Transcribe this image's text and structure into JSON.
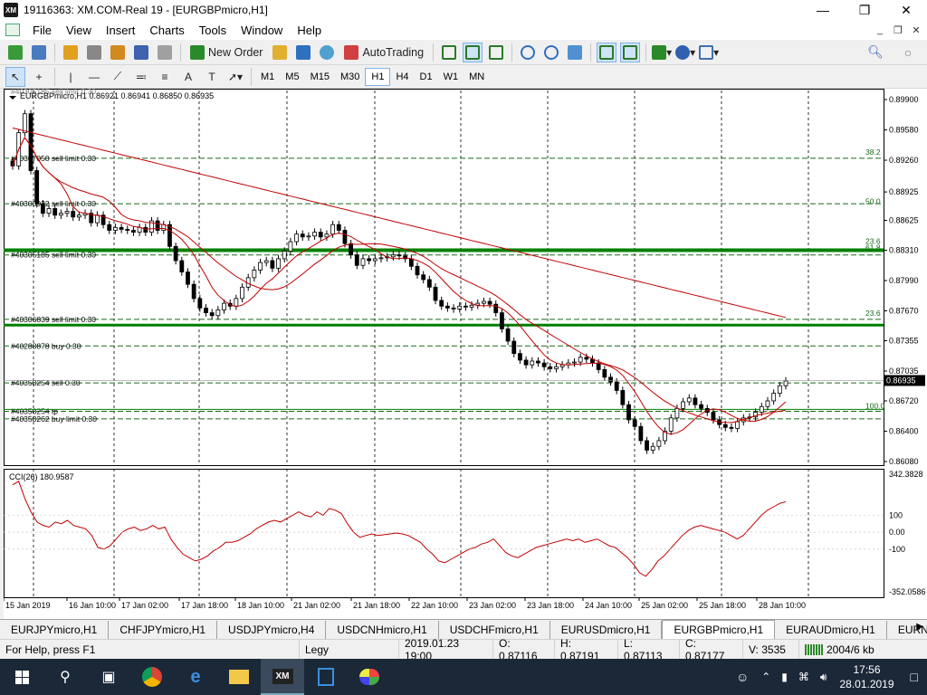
{
  "window": {
    "title": "19116363: XM.COM-Real 19 - [EURGBPmicro,H1]",
    "icon_text": "XM"
  },
  "menu": [
    "File",
    "View",
    "Insert",
    "Charts",
    "Tools",
    "Window",
    "Help"
  ],
  "toolbar": {
    "new_order": "New Order",
    "auto_trading": "AutoTrading"
  },
  "timeframes": [
    "M1",
    "M5",
    "M15",
    "M30",
    "H1",
    "H4",
    "D1",
    "W1",
    "MN"
  ],
  "active_timeframe": "H1",
  "chart_data": {
    "type": "candlestick",
    "symbol_header": "EURGBPmicro,H1  0.86921 0.86941 0.86850 0.86935",
    "y_ticks": [
      "0.89900",
      "0.89580",
      "0.89260",
      "0.88925",
      "0.88625",
      "0.88310",
      "0.87990",
      "0.87670",
      "0.87355",
      "0.87035",
      "0.86720",
      "0.86400",
      "0.86080"
    ],
    "current_price": "0.86935",
    "x_ticks": [
      "15 Jan 2019",
      "16 Jan 10:00",
      "17 Jan 02:00",
      "17 Jan 18:00",
      "18 Jan 10:00",
      "21 Jan 02:00",
      "21 Jan 18:00",
      "22 Jan 10:00",
      "23 Jan 02:00",
      "23 Jan 18:00",
      "24 Jan 10:00",
      "25 Jan 02:00",
      "25 Jan 18:00",
      "28 Jan 10:00"
    ],
    "close": [
      0.892,
      0.8955,
      0.8975,
      0.8915,
      0.888,
      0.887,
      0.8875,
      0.8868,
      0.887,
      0.8872,
      0.8866,
      0.8868,
      0.887,
      0.886,
      0.8868,
      0.8858,
      0.8852,
      0.8855,
      0.8853,
      0.8852,
      0.885,
      0.8855,
      0.885,
      0.8862,
      0.8852,
      0.8858,
      0.8835,
      0.882,
      0.8808,
      0.8795,
      0.878,
      0.877,
      0.8765,
      0.8762,
      0.8768,
      0.8775,
      0.8772,
      0.878,
      0.8792,
      0.8802,
      0.881,
      0.8818,
      0.882,
      0.8812,
      0.8822,
      0.883,
      0.884,
      0.8848,
      0.8845,
      0.8846,
      0.885,
      0.8845,
      0.8848,
      0.8858,
      0.8852,
      0.8838,
      0.8826,
      0.8815,
      0.8822,
      0.882,
      0.8822,
      0.8823,
      0.8824,
      0.8826,
      0.8825,
      0.8822,
      0.8814,
      0.8805,
      0.88,
      0.8792,
      0.8778,
      0.8772,
      0.877,
      0.8769,
      0.8772,
      0.8771,
      0.8773,
      0.8775,
      0.8777,
      0.8774,
      0.8765,
      0.8748,
      0.8735,
      0.8722,
      0.8715,
      0.871,
      0.8714,
      0.8712,
      0.8708,
      0.8706,
      0.8708,
      0.871,
      0.8712,
      0.8713,
      0.8718,
      0.8716,
      0.8712,
      0.8705,
      0.8697,
      0.8692,
      0.8683,
      0.8668,
      0.8652,
      0.8645,
      0.863,
      0.862,
      0.8624,
      0.863,
      0.864,
      0.8654,
      0.8664,
      0.8671,
      0.8675,
      0.8668,
      0.8664,
      0.866,
      0.8652,
      0.8647,
      0.8644,
      0.8643,
      0.865,
      0.8654,
      0.8655,
      0.866,
      0.8666,
      0.8672,
      0.868,
      0.8688,
      0.8693
    ],
    "annotations": [
      {
        "label": "#40307050 sell limit 0.30",
        "price": 0.8928
      },
      {
        "label": "#40300932 sell limit 0.30",
        "price": 0.888
      },
      {
        "label": "#40305185 sell limit 0.30",
        "price": 0.8826
      },
      {
        "label": "#40306839 sell limit 0.30",
        "price": 0.8758
      },
      {
        "label": "#40288878 buy 0.30",
        "price": 0.873
      },
      {
        "label": "#40358254 sell 0.30",
        "price": 0.8691
      },
      {
        "label": "#40358254 tp",
        "price": 0.8661
      },
      {
        "label": "#40358262 buy limit 0.30",
        "price": 0.8653
      }
    ],
    "top_order_label": "#40305185 sell limit 0.30",
    "fib_levels": [
      {
        "label": "38.2",
        "price": 0.893
      },
      {
        "label": "50.0",
        "price": 0.8878
      },
      {
        "label": "23.6",
        "price": 0.8836
      },
      {
        "label": "61.8",
        "price": 0.8829
      },
      {
        "label": "23.6",
        "price": 0.876
      },
      {
        "label": "100.0",
        "price": 0.8662
      }
    ],
    "indicator": {
      "title": "CCI(26) 180.9587",
      "y_ticks": [
        "342.3828",
        "100",
        "0.00",
        "-100",
        "-352.0586"
      ],
      "values": [
        280,
        300,
        200,
        120,
        60,
        40,
        30,
        60,
        50,
        70,
        40,
        30,
        20,
        -20,
        -90,
        -100,
        -80,
        -40,
        0,
        20,
        30,
        10,
        20,
        40,
        20,
        30,
        -40,
        -90,
        -130,
        -150,
        -170,
        -160,
        -140,
        -110,
        -90,
        -60,
        -60,
        -50,
        -30,
        -10,
        20,
        40,
        60,
        70,
        60,
        80,
        100,
        120,
        100,
        90,
        120,
        100,
        140,
        130,
        110,
        50,
        0,
        -30,
        -20,
        -10,
        -20,
        -15,
        -10,
        -5,
        -10,
        -20,
        -40,
        -60,
        -100,
        -130,
        -170,
        -180,
        -160,
        -140,
        -120,
        -100,
        -90,
        -70,
        -60,
        -40,
        -80,
        -120,
        -140,
        -150,
        -130,
        -110,
        -90,
        -80,
        -70,
        -60,
        -50,
        -40,
        -50,
        -40,
        -60,
        -50,
        -40,
        -60,
        -80,
        -90,
        -120,
        -150,
        -190,
        -240,
        -260,
        -220,
        -170,
        -140,
        -100,
        -60,
        -20,
        10,
        30,
        40,
        30,
        20,
        10,
        0,
        -20,
        -40,
        -20,
        20,
        60,
        100,
        130,
        150,
        170,
        180
      ]
    }
  },
  "tabs": [
    "EURJPYmicro,H1",
    "CHFJPYmicro,H1",
    "USDJPYmicro,H4",
    "USDCNHmicro,H1",
    "USDCHFmicro,H1",
    "EURUSDmicro,H1",
    "EURGBPmicro,H1",
    "EURAUDmicro,H1",
    "EURNZDr"
  ],
  "active_tab": "EURGBPmicro,H1",
  "status": {
    "help": "For Help, press F1",
    "profile": "Legy",
    "time": "2019.01.23 19:00",
    "open": "O: 0.87116",
    "high": "H: 0.87191",
    "low": "L: 0.87113",
    "close": "C: 0.87177",
    "volume": "V: 3535",
    "traffic": "2004/6 kb"
  },
  "taskbar": {
    "clock_time": "17:56",
    "clock_date": "28.01.2019"
  },
  "colors": {
    "bull": "#000000",
    "ma": "#c00000",
    "grid": "#000000",
    "order_line": "#006400",
    "cci": "#c00000"
  }
}
